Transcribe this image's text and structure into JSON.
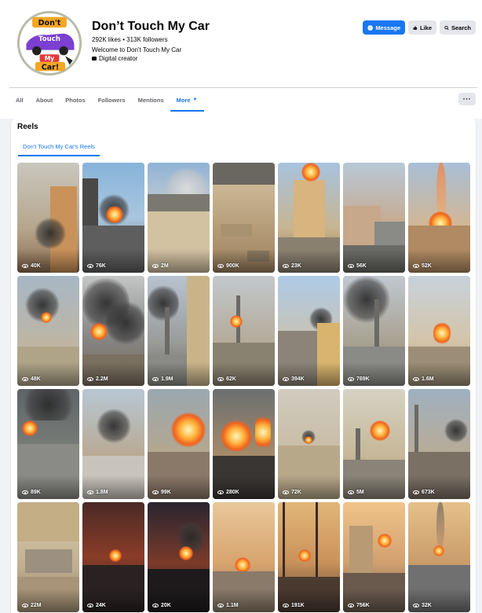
{
  "page": {
    "name": "Don’t Touch My Car",
    "stats": "292K likes • 313K followers",
    "intro": "Welcome to Don't Touch My Car",
    "category": "Digital creator",
    "avatar_logo_text": [
      "Don't",
      "Touch",
      "My",
      "Car!"
    ]
  },
  "actions": {
    "message": "Message",
    "like": "Like",
    "search": "Search"
  },
  "tabs": [
    "All",
    "About",
    "Photos",
    "Followers",
    "Mentions",
    "More"
  ],
  "active_tab": "More",
  "more_menu": "···",
  "reels": {
    "title": "Reels",
    "subtab": "Don't Touch My Car's Reels",
    "items": [
      {
        "views": "40K"
      },
      {
        "views": "76K"
      },
      {
        "views": "2M"
      },
      {
        "views": "900K"
      },
      {
        "views": "23K"
      },
      {
        "views": "56K"
      },
      {
        "views": "52K"
      },
      {
        "views": "48K"
      },
      {
        "views": "2.2M"
      },
      {
        "views": "1.9M"
      },
      {
        "views": "62K"
      },
      {
        "views": "394K"
      },
      {
        "views": "769K"
      },
      {
        "views": "1.6M"
      },
      {
        "views": "89K"
      },
      {
        "views": "1.8M"
      },
      {
        "views": "99K"
      },
      {
        "views": "280K"
      },
      {
        "views": "72K"
      },
      {
        "views": "5M"
      },
      {
        "views": "673K"
      },
      {
        "views": "22M"
      },
      {
        "views": "24K"
      },
      {
        "views": "20K"
      },
      {
        "views": "1.1M"
      },
      {
        "views": "191K"
      },
      {
        "views": "756K"
      },
      {
        "views": "32K"
      }
    ]
  },
  "colors": {
    "accent": "#1877f2",
    "background": "#f0f2f5",
    "secondary_button": "#e4e6eb"
  }
}
